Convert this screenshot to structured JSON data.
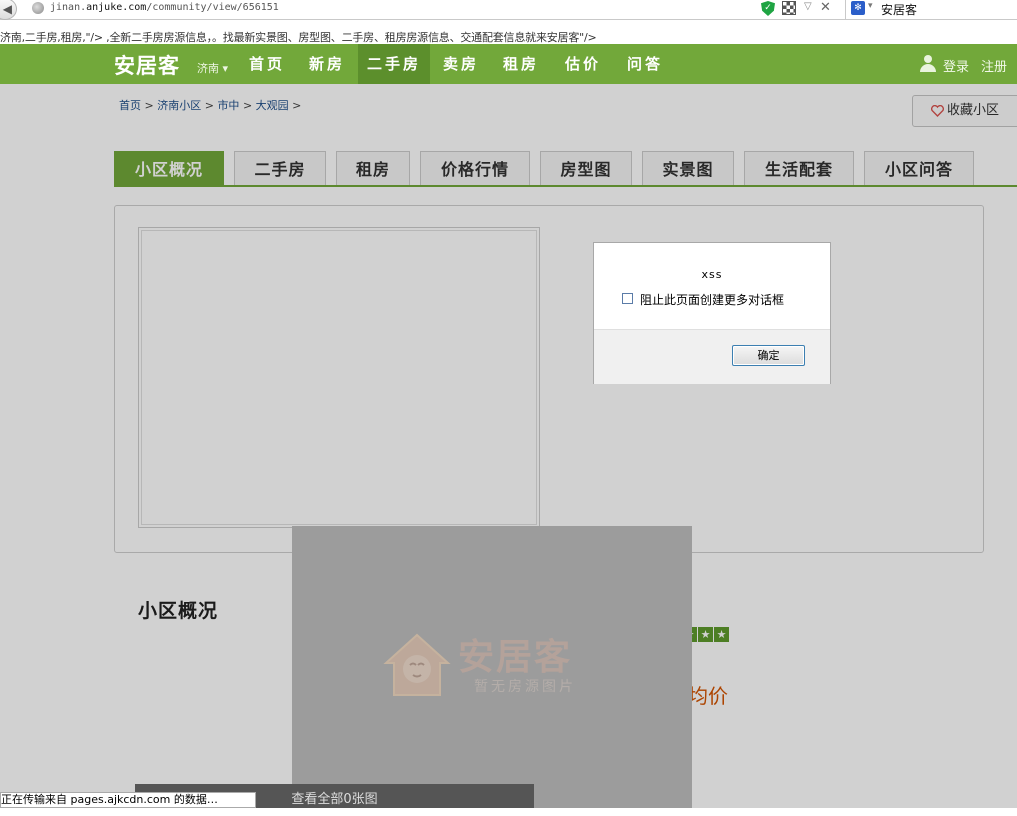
{
  "browser": {
    "url_prefix": "jinan.",
    "url_domain": "anjuke.com",
    "url_path": "/community/view/656151",
    "search_engine_text": "安居客"
  },
  "leaked_meta_text": "济南,二手房,租房,\"/> ,全新二手房房源信息，。找最新实景图、房型图、二手房、租房房源信息、交通配套信息就来安居客\"/>",
  "nav": {
    "logo": "安居客",
    "city": "济南",
    "items": [
      "首页",
      "新房",
      "二手房",
      "卖房",
      "租房",
      "估价",
      "问答"
    ],
    "login": "登录",
    "register": "注册"
  },
  "breadcrumb": {
    "items": [
      "首页",
      "济南小区",
      "市中",
      "大观园"
    ],
    "separator": ">"
  },
  "favorite_label": "收藏小区",
  "tabs": [
    "小区概况",
    "二手房",
    "租房",
    "价格行情",
    "房型图",
    "实景图",
    "生活配套",
    "小区问答"
  ],
  "section_title": "小区概况",
  "rating_stars": 5,
  "avg_price_label": "均价",
  "placeholder": {
    "brand": "安居客",
    "subtitle": "暂无房源图片"
  },
  "view_all_label": "查看全部0张图",
  "dialog": {
    "message": "xss",
    "checkbox_label": "阻止此页面创建更多对话框",
    "ok_label": "确定"
  },
  "status_text": "正在传输来自 pages.ajkcdn.com 的数据…",
  "colors": {
    "brand_green": "#72a83a",
    "price_orange": "#d35400"
  }
}
